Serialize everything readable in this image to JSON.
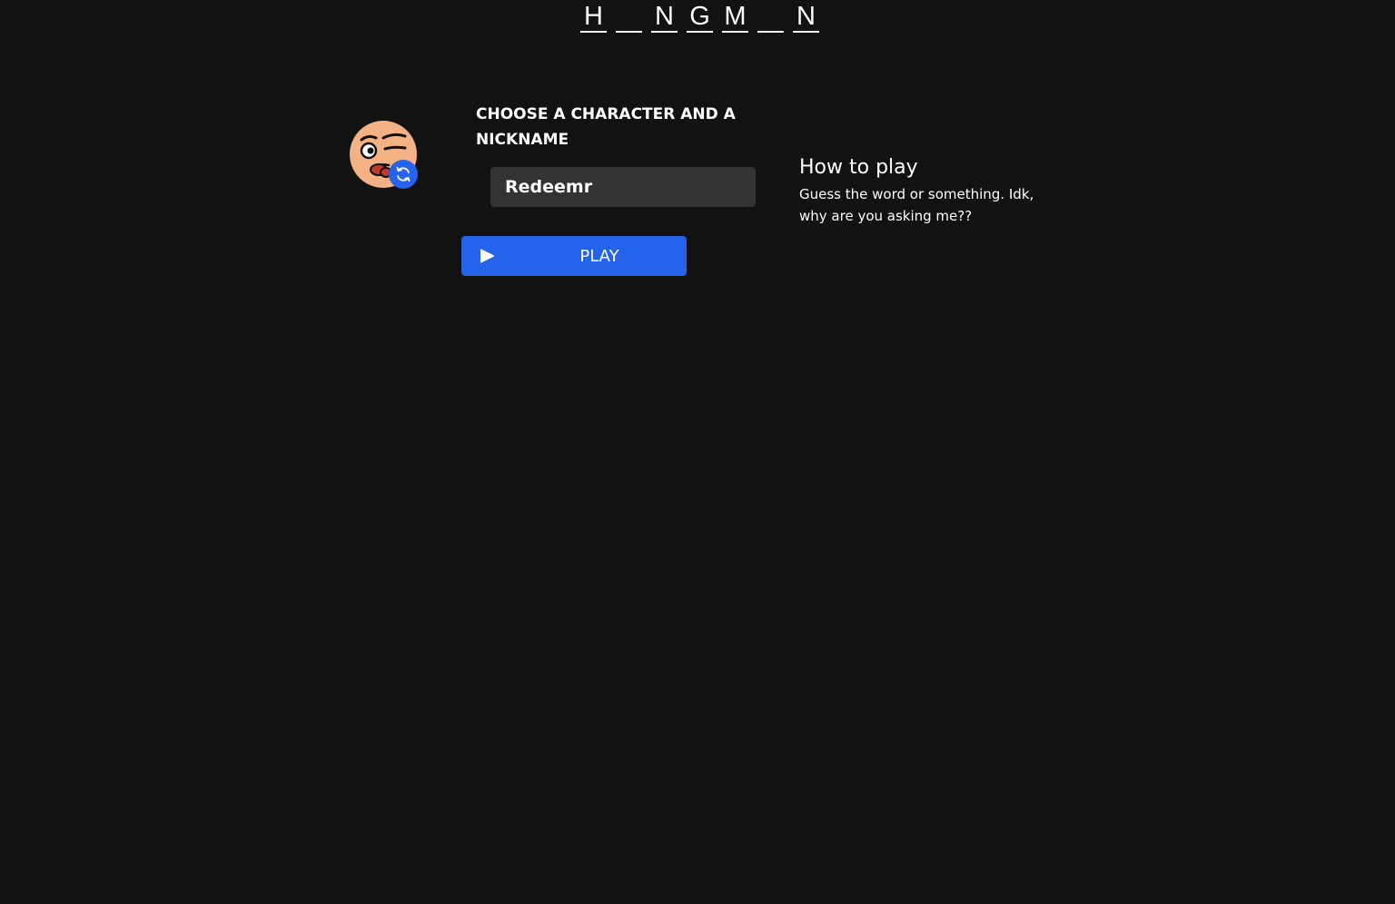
{
  "title": {
    "letters": [
      "H",
      "",
      "N",
      "G",
      "M",
      "",
      "N"
    ]
  },
  "character": {
    "avatar_icon": "winking-face-tongue-icon",
    "refresh_icon": "refresh-icon",
    "skin_color": "#f4b183"
  },
  "setup": {
    "heading": "CHOOSE A CHARACTER AND A NICKNAME",
    "nickname_value": "Redeemr",
    "play_label": "PLAY",
    "play_icon": "play-icon"
  },
  "how_to_play": {
    "title": "How to play",
    "text": "Guess the word or something. Idk, why are you asking me??"
  },
  "colors": {
    "background": "#121212",
    "accent": "#2563eb",
    "input_bg": "#333333"
  }
}
